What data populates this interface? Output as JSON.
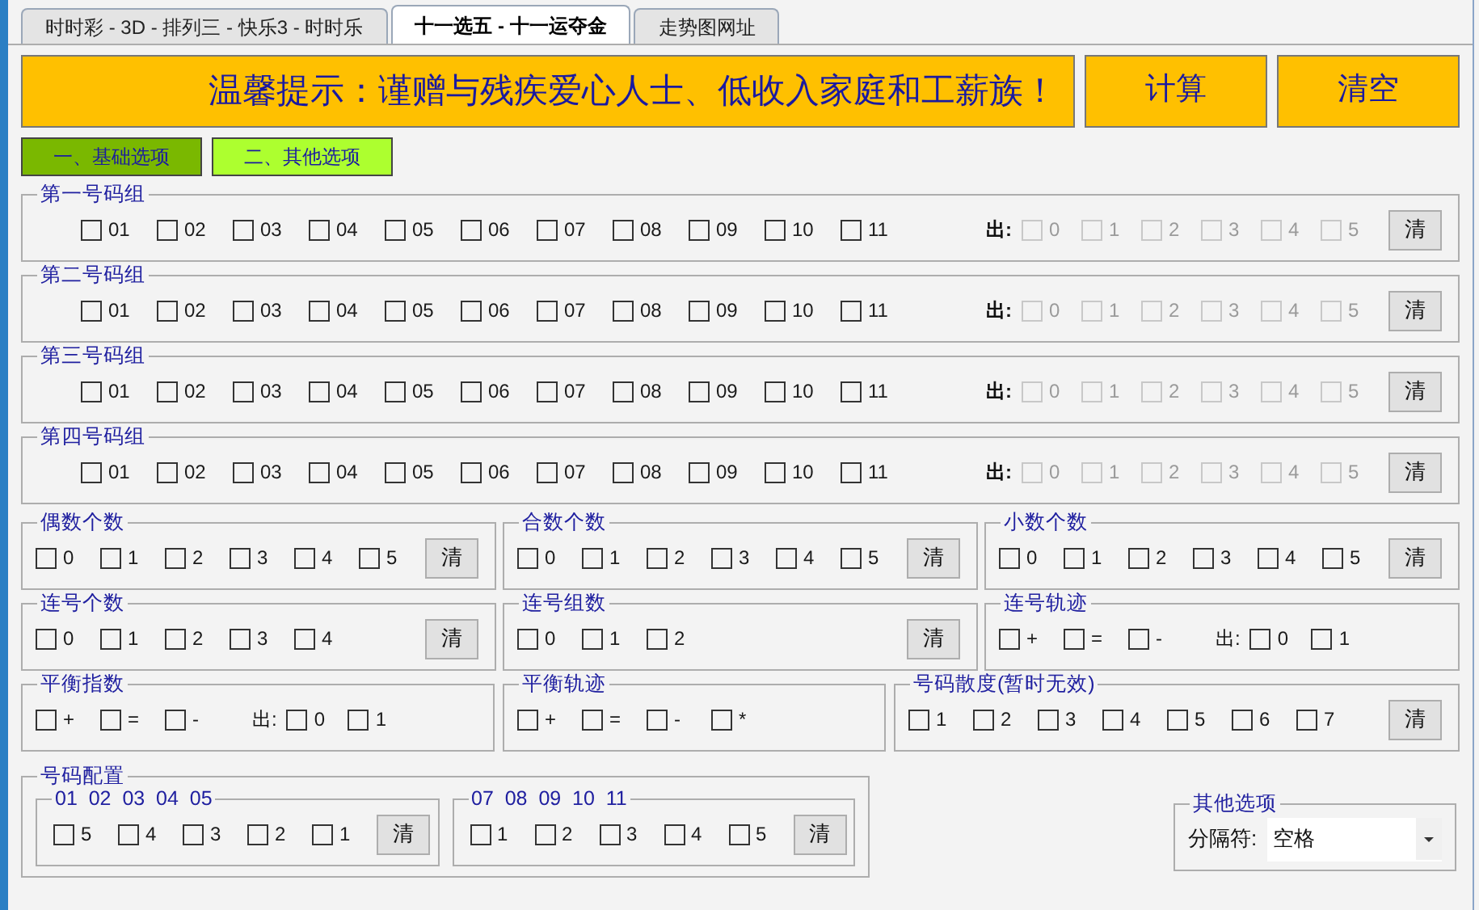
{
  "tabs": [
    {
      "label": "时时彩 - 3D - 排列三 - 快乐3 - 时时乐",
      "selected": false
    },
    {
      "label": "十一选五 - 十一运夺金",
      "selected": true
    },
    {
      "label": "走势图网址",
      "selected": false
    }
  ],
  "notice": "温馨提示：谨赠与残疾爱心人士、低收入家庭和工薪族！",
  "action_buttons": [
    "计算",
    "清空"
  ],
  "option_tabs": [
    {
      "label": "一、基础选项",
      "selected": true
    },
    {
      "label": "二、其他选项",
      "selected": false
    }
  ],
  "number_groups": [
    {
      "title": "第一号码组",
      "options": [
        {
          "label": "01",
          "checked": false
        },
        {
          "label": "02",
          "checked": false
        },
        {
          "label": "03",
          "checked": false
        },
        {
          "label": "04",
          "checked": false
        },
        {
          "label": "05",
          "checked": false
        },
        {
          "label": "06",
          "checked": false
        },
        {
          "label": "07",
          "checked": false
        },
        {
          "label": "08",
          "checked": false
        },
        {
          "label": "09",
          "checked": false
        },
        {
          "label": "10",
          "checked": false
        },
        {
          "label": "11",
          "checked": false
        }
      ],
      "out_label": "出:",
      "out_options": [
        {
          "label": "0",
          "checked": false,
          "disabled": true
        },
        {
          "label": "1",
          "checked": false,
          "disabled": true
        },
        {
          "label": "2",
          "checked": false,
          "disabled": true
        },
        {
          "label": "3",
          "checked": false,
          "disabled": true
        },
        {
          "label": "4",
          "checked": false,
          "disabled": true
        },
        {
          "label": "5",
          "checked": false,
          "disabled": true
        }
      ],
      "clear": "清"
    },
    {
      "title": "第二号码组",
      "options": [
        {
          "label": "01",
          "checked": false
        },
        {
          "label": "02",
          "checked": false
        },
        {
          "label": "03",
          "checked": false
        },
        {
          "label": "04",
          "checked": false
        },
        {
          "label": "05",
          "checked": false
        },
        {
          "label": "06",
          "checked": false
        },
        {
          "label": "07",
          "checked": false
        },
        {
          "label": "08",
          "checked": false
        },
        {
          "label": "09",
          "checked": false
        },
        {
          "label": "10",
          "checked": false
        },
        {
          "label": "11",
          "checked": false
        }
      ],
      "out_label": "出:",
      "out_options": [
        {
          "label": "0",
          "checked": false,
          "disabled": true
        },
        {
          "label": "1",
          "checked": false,
          "disabled": true
        },
        {
          "label": "2",
          "checked": false,
          "disabled": true
        },
        {
          "label": "3",
          "checked": false,
          "disabled": true
        },
        {
          "label": "4",
          "checked": false,
          "disabled": true
        },
        {
          "label": "5",
          "checked": false,
          "disabled": true
        }
      ],
      "clear": "清"
    },
    {
      "title": "第三号码组",
      "options": [
        {
          "label": "01",
          "checked": false
        },
        {
          "label": "02",
          "checked": false
        },
        {
          "label": "03",
          "checked": false
        },
        {
          "label": "04",
          "checked": false
        },
        {
          "label": "05",
          "checked": false
        },
        {
          "label": "06",
          "checked": false
        },
        {
          "label": "07",
          "checked": false
        },
        {
          "label": "08",
          "checked": false
        },
        {
          "label": "09",
          "checked": false
        },
        {
          "label": "10",
          "checked": false
        },
        {
          "label": "11",
          "checked": false
        }
      ],
      "out_label": "出:",
      "out_options": [
        {
          "label": "0",
          "checked": false,
          "disabled": true
        },
        {
          "label": "1",
          "checked": false,
          "disabled": true
        },
        {
          "label": "2",
          "checked": false,
          "disabled": true
        },
        {
          "label": "3",
          "checked": false,
          "disabled": true
        },
        {
          "label": "4",
          "checked": false,
          "disabled": true
        },
        {
          "label": "5",
          "checked": false,
          "disabled": true
        }
      ],
      "clear": "清"
    },
    {
      "title": "第四号码组",
      "options": [
        {
          "label": "01",
          "checked": false
        },
        {
          "label": "02",
          "checked": false
        },
        {
          "label": "03",
          "checked": false
        },
        {
          "label": "04",
          "checked": false
        },
        {
          "label": "05",
          "checked": false
        },
        {
          "label": "06",
          "checked": false
        },
        {
          "label": "07",
          "checked": false
        },
        {
          "label": "08",
          "checked": false
        },
        {
          "label": "09",
          "checked": false
        },
        {
          "label": "10",
          "checked": false
        },
        {
          "label": "11",
          "checked": false
        }
      ],
      "out_label": "出:",
      "out_options": [
        {
          "label": "0",
          "checked": false,
          "disabled": true
        },
        {
          "label": "1",
          "checked": false,
          "disabled": true
        },
        {
          "label": "2",
          "checked": false,
          "disabled": true
        },
        {
          "label": "3",
          "checked": false,
          "disabled": true
        },
        {
          "label": "4",
          "checked": false,
          "disabled": true
        },
        {
          "label": "5",
          "checked": false,
          "disabled": true
        }
      ],
      "clear": "清"
    }
  ],
  "filter_rows": [
    [
      {
        "title": "偶数个数",
        "options": [
          {
            "label": "0",
            "checked": false
          },
          {
            "label": "1",
            "checked": false
          },
          {
            "label": "2",
            "checked": false
          },
          {
            "label": "3",
            "checked": false
          },
          {
            "label": "4",
            "checked": false
          },
          {
            "label": "5",
            "checked": false
          }
        ],
        "clear": "清"
      },
      {
        "title": "合数个数",
        "options": [
          {
            "label": "0",
            "checked": false
          },
          {
            "label": "1",
            "checked": false
          },
          {
            "label": "2",
            "checked": false
          },
          {
            "label": "3",
            "checked": false
          },
          {
            "label": "4",
            "checked": false
          },
          {
            "label": "5",
            "checked": false
          }
        ],
        "clear": "清"
      },
      {
        "title": "小数个数",
        "options": [
          {
            "label": "0",
            "checked": false
          },
          {
            "label": "1",
            "checked": false
          },
          {
            "label": "2",
            "checked": false
          },
          {
            "label": "3",
            "checked": false
          },
          {
            "label": "4",
            "checked": false
          },
          {
            "label": "5",
            "checked": false
          }
        ],
        "clear": "清"
      }
    ],
    [
      {
        "title": "连号个数",
        "options": [
          {
            "label": "0",
            "checked": false
          },
          {
            "label": "1",
            "checked": false
          },
          {
            "label": "2",
            "checked": false
          },
          {
            "label": "3",
            "checked": false
          },
          {
            "label": "4",
            "checked": false
          }
        ],
        "clear": "清"
      },
      {
        "title": "连号组数",
        "options": [
          {
            "label": "0",
            "checked": false
          },
          {
            "label": "1",
            "checked": false
          },
          {
            "label": "2",
            "checked": false
          }
        ],
        "clear": "清"
      },
      {
        "title": "连号轨迹",
        "options": [
          {
            "label": "+",
            "checked": false
          },
          {
            "label": "=",
            "checked": false
          },
          {
            "label": "-",
            "checked": false
          }
        ],
        "out_label": "出:",
        "out_options": [
          {
            "label": "0",
            "checked": false
          },
          {
            "label": "1",
            "checked": false
          }
        ]
      }
    ],
    [
      {
        "title": "平衡指数",
        "options": [
          {
            "label": "+",
            "checked": false
          },
          {
            "label": "=",
            "checked": false
          },
          {
            "label": "-",
            "checked": false
          }
        ],
        "out_label": "出:",
        "out_options": [
          {
            "label": "0",
            "checked": false
          },
          {
            "label": "1",
            "checked": false
          }
        ]
      },
      {
        "title": "平衡轨迹",
        "options": [
          {
            "label": "+",
            "checked": false
          },
          {
            "label": "=",
            "checked": false
          },
          {
            "label": "-",
            "checked": false
          },
          {
            "label": "*",
            "checked": false
          }
        ]
      },
      {
        "title": "号码散度(暂时无效)",
        "options": [
          {
            "label": "1",
            "checked": false
          },
          {
            "label": "2",
            "checked": false
          },
          {
            "label": "3",
            "checked": false
          },
          {
            "label": "4",
            "checked": false
          },
          {
            "label": "5",
            "checked": false
          },
          {
            "label": "6",
            "checked": false
          },
          {
            "label": "7",
            "checked": false
          }
        ],
        "clear": "清"
      }
    ]
  ],
  "config": {
    "title": "号码配置",
    "groups": [
      {
        "title": "01  02  03  04  05",
        "options": [
          {
            "label": "5",
            "checked": false
          },
          {
            "label": "4",
            "checked": false
          },
          {
            "label": "3",
            "checked": false
          },
          {
            "label": "2",
            "checked": false
          },
          {
            "label": "1",
            "checked": false
          }
        ],
        "clear": "清"
      },
      {
        "title": "07  08  09  10  11",
        "options": [
          {
            "label": "1",
            "checked": false
          },
          {
            "label": "2",
            "checked": false
          },
          {
            "label": "3",
            "checked": false
          },
          {
            "label": "4",
            "checked": false
          },
          {
            "label": "5",
            "checked": false
          }
        ],
        "clear": "清"
      }
    ]
  },
  "other_options": {
    "title": "其他选项",
    "label": "分隔符:",
    "value": "空格"
  }
}
